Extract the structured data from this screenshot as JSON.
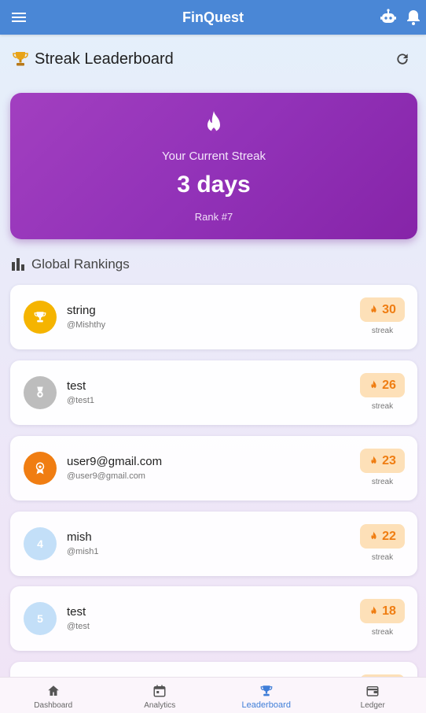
{
  "app": {
    "title": "FinQuest"
  },
  "header": {
    "title": "Streak Leaderboard"
  },
  "streak": {
    "label": "Your Current Streak",
    "value": "3 days",
    "rank": "Rank #7"
  },
  "section": {
    "title": "Global Rankings"
  },
  "rankings": [
    {
      "name": "string",
      "handle": "@Mishthy",
      "streak": "30",
      "streak_label": "streak",
      "avatar": "trophy-icon",
      "avatar_color": "#f5b400"
    },
    {
      "name": "test",
      "handle": "@test1",
      "streak": "26",
      "streak_label": "streak",
      "avatar": "medal-icon",
      "avatar_color": "#bdbdbd"
    },
    {
      "name": "user9@gmail.com",
      "handle": "@user9@gmail.com",
      "streak": "23",
      "streak_label": "streak",
      "avatar": "award-icon",
      "avatar_color": "#f07d12"
    },
    {
      "name": "mish",
      "handle": "@mish1",
      "streak": "22",
      "streak_label": "streak",
      "avatar": "4",
      "avatar_color": "#c3dff8"
    },
    {
      "name": "test",
      "handle": "@test",
      "streak": "18",
      "streak_label": "streak",
      "avatar": "5",
      "avatar_color": "#c3dff8"
    }
  ],
  "nav": {
    "items": [
      {
        "label": "Dashboard",
        "icon": "home-icon"
      },
      {
        "label": "Analytics",
        "icon": "calendar-icon"
      },
      {
        "label": "Leaderboard",
        "icon": "trophy-icon",
        "active": true
      },
      {
        "label": "Ledger",
        "icon": "wallet-icon"
      }
    ]
  },
  "colors": {
    "primary": "#4a87d6",
    "card": "#9a35bb",
    "badge": "#fde0b8",
    "badge_text": "#ef7d12"
  }
}
